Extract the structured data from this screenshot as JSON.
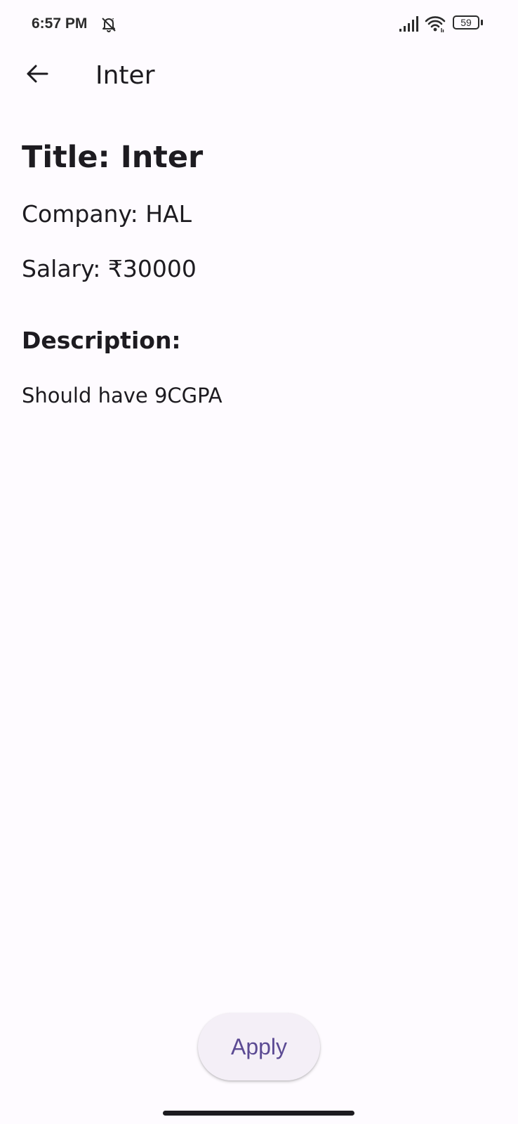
{
  "status_bar": {
    "time": "6:57 PM",
    "battery_level": "59",
    "icons": [
      "do-not-disturb-icon",
      "signal-icon",
      "wifi-icon",
      "battery-icon"
    ]
  },
  "app_bar": {
    "title": "Inter",
    "back_icon": "arrow-back-icon"
  },
  "job": {
    "title_text": "Title: Inter",
    "company_text": "Company: HAL",
    "salary_text": "Salary: ₹30000",
    "description_heading": "Description:",
    "description_text": "Should have 9CGPA"
  },
  "actions": {
    "apply_label": "Apply"
  },
  "colors": {
    "background": "#fefbff",
    "text": "#1d1b20",
    "button_surface": "#f4eff7",
    "button_text": "#5b4a93"
  }
}
